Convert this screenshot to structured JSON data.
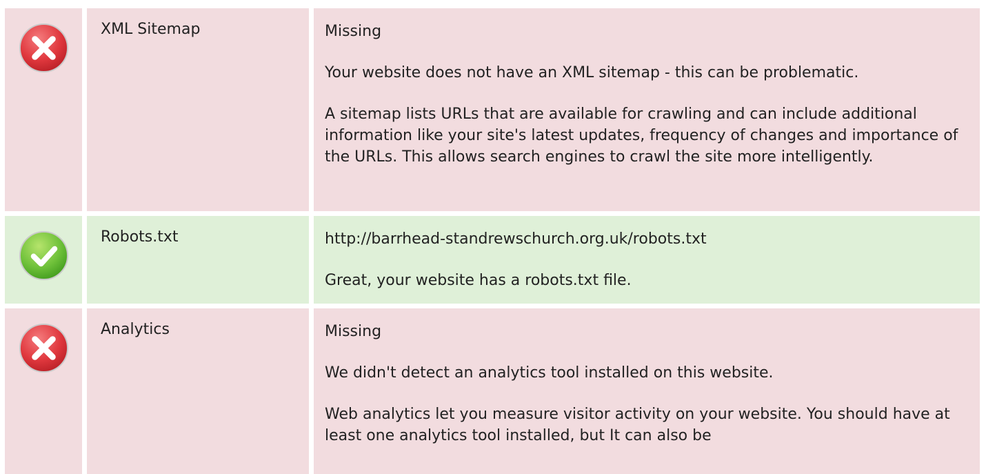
{
  "colors": {
    "fail_background": "#f2dcdf",
    "pass_background": "#dff0d8",
    "fail_icon": "#e0383e",
    "pass_icon": "#6fc13a"
  },
  "checks": [
    {
      "status": "fail",
      "icon": "close-icon",
      "label": "XML Sitemap",
      "paragraphs": [
        "Missing",
        "Your website does not have an XML sitemap - this can be problematic.",
        "A sitemap lists URLs that are available for crawling and can include additional information like your site's latest updates, frequency of changes and importance of the URLs. This allows search engines to crawl the site more intelligently."
      ]
    },
    {
      "status": "pass",
      "icon": "check-icon",
      "label": "Robots.txt",
      "paragraphs": [
        "http://barrhead-standrewschurch.org.uk/robots.txt",
        "Great, your website has a robots.txt file."
      ]
    },
    {
      "status": "fail",
      "icon": "close-icon",
      "label": "Analytics",
      "paragraphs": [
        "Missing",
        "We didn't detect an analytics tool installed on this website.",
        "Web analytics let you measure visitor activity on your website. You should have at least one analytics tool installed, but It can also be"
      ]
    }
  ]
}
